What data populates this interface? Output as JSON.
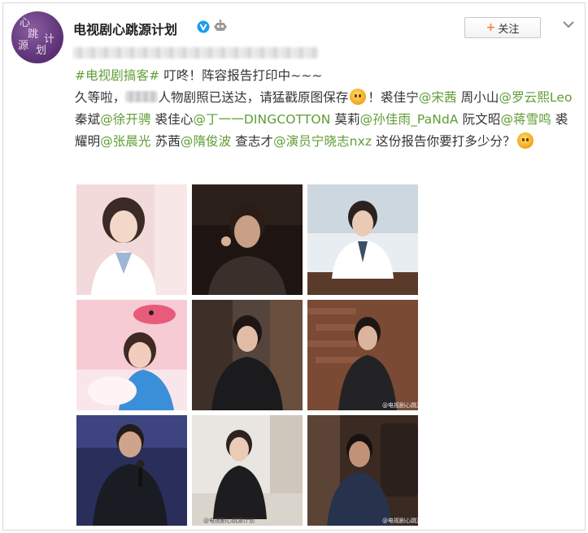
{
  "header": {
    "username": "电视剧心跳源计划",
    "follow_label": "关注",
    "avatar_chars": [
      "心",
      "跳",
      "源",
      "计",
      "划"
    ]
  },
  "post": {
    "hashtag": "#电视剧搞客#",
    "intro": " 叮咚！阵容报告打印中~~~",
    "line2_a": "久等啦，",
    "line2_b": "人物剧照已送达，请猛戳原图保存",
    "line2_c": "！裘佳宁",
    "m1": "@宋茜",
    "t1": " 周小山",
    "m2": "@罗云熙Leo",
    "t2": " 秦斌",
    "m3": "@徐开骋",
    "t3": " 裘佳心",
    "m4": "@丁一一DINGCOTTON",
    "t4": " 莫莉",
    "m5": "@孙佳雨_PaNdA",
    "t5": " 阮文昭",
    "m6": "@蒋雪鸣",
    "t6": " 裘耀明",
    "m7": "@张晨光",
    "t7": " 苏茜",
    "m8": "@隋俊波",
    "t8": " 查志才",
    "m9": "@演员宁晓志nxz",
    "t9": " 这份报告你要打多少分？"
  },
  "photos": {
    "watermark": "@电视剧心跳源计划"
  },
  "colors": {
    "link": "#5f9d34",
    "accent": "#ff8140"
  }
}
